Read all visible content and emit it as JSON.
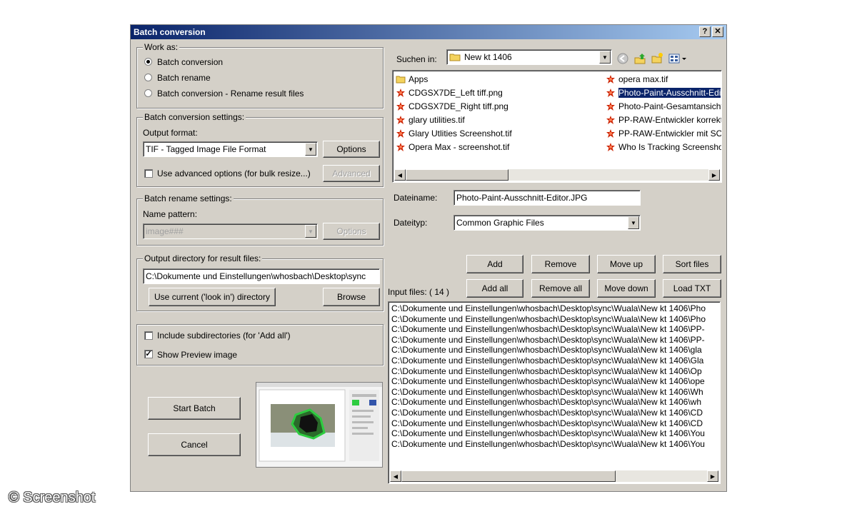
{
  "window": {
    "title": "Batch conversion",
    "help_label": "?",
    "close_label": "✕"
  },
  "work_as": {
    "legend": "Work as:",
    "options": [
      {
        "label": "Batch conversion",
        "selected": true
      },
      {
        "label": "Batch rename",
        "selected": false
      },
      {
        "label": "Batch conversion - Rename result files",
        "selected": false
      }
    ]
  },
  "conversion_settings": {
    "legend": "Batch conversion settings:",
    "output_format_label": "Output format:",
    "output_format_value": "TIF - Tagged Image File Format",
    "options_button": "Options",
    "advanced_checkbox_label": "Use advanced options (for bulk resize...)",
    "advanced_checked": false,
    "advanced_button": "Advanced"
  },
  "rename_settings": {
    "legend": "Batch rename settings:",
    "name_pattern_label": "Name pattern:",
    "name_pattern_value": "image###",
    "options_button": "Options"
  },
  "output_dir": {
    "legend": "Output directory for result files:",
    "path": "C:\\Dokumente und Einstellungen\\whosbach\\Desktop\\sync",
    "use_current_button": "Use current ('look in') directory",
    "browse_button": "Browse"
  },
  "flags": {
    "include_subdirs_label": "Include subdirectories (for 'Add all')",
    "include_subdirs_checked": false,
    "show_preview_label": "Show Preview image",
    "show_preview_checked": true
  },
  "actions": {
    "start_label": "Start Batch",
    "cancel_label": "Cancel"
  },
  "browser": {
    "look_in_label": "Suchen in:",
    "look_in_value": "New kt 1406",
    "files_col1": [
      {
        "name": "Apps",
        "type": "folder"
      },
      {
        "name": "CDGSX7DE_Left tiff.png",
        "type": "image"
      },
      {
        "name": "CDGSX7DE_Right tiff.png",
        "type": "image"
      },
      {
        "name": "glary utilities.tif",
        "type": "image"
      },
      {
        "name": "Glary Utlities Screenshot.tif",
        "type": "image"
      },
      {
        "name": "Opera Max - screenshot.tif",
        "type": "image"
      }
    ],
    "files_col2": [
      {
        "name": "opera max.tif",
        "type": "image",
        "selected": false
      },
      {
        "name": "Photo-Paint-Ausschnitt-Edi",
        "type": "image",
        "selected": true
      },
      {
        "name": "Photo-Paint-Gesamtansicht",
        "type": "image",
        "selected": false
      },
      {
        "name": "PP-RAW-Entwickler korrekt",
        "type": "image",
        "selected": false
      },
      {
        "name": "PP-RAW-Entwickler mit SOI",
        "type": "image",
        "selected": false
      },
      {
        "name": "Who Is Tracking Screensho",
        "type": "image",
        "selected": false
      }
    ],
    "filename_label": "Dateiname:",
    "filename_value": "Photo-Paint-Ausschnitt-Editor.JPG",
    "filetype_label": "Dateityp:",
    "filetype_value": "Common Graphic Files"
  },
  "input": {
    "buttons_row1": [
      "Add",
      "Remove",
      "Move up",
      "Sort files"
    ],
    "buttons_row2": [
      "Add all",
      "Remove all",
      "Move down",
      "Load TXT"
    ],
    "label": "Input files: ( 14 )",
    "files": [
      "C:\\Dokumente und Einstellungen\\whosbach\\Desktop\\sync\\Wuala\\New kt 1406\\Pho",
      "C:\\Dokumente und Einstellungen\\whosbach\\Desktop\\sync\\Wuala\\New kt 1406\\Pho",
      "C:\\Dokumente und Einstellungen\\whosbach\\Desktop\\sync\\Wuala\\New kt 1406\\PP-",
      "C:\\Dokumente und Einstellungen\\whosbach\\Desktop\\sync\\Wuala\\New kt 1406\\PP-",
      "C:\\Dokumente und Einstellungen\\whosbach\\Desktop\\sync\\Wuala\\New kt 1406\\gla",
      "C:\\Dokumente und Einstellungen\\whosbach\\Desktop\\sync\\Wuala\\New kt 1406\\Gla",
      "C:\\Dokumente und Einstellungen\\whosbach\\Desktop\\sync\\Wuala\\New kt 1406\\Op",
      "C:\\Dokumente und Einstellungen\\whosbach\\Desktop\\sync\\Wuala\\New kt 1406\\ope",
      "C:\\Dokumente und Einstellungen\\whosbach\\Desktop\\sync\\Wuala\\New kt 1406\\Wh",
      "C:\\Dokumente und Einstellungen\\whosbach\\Desktop\\sync\\Wuala\\New kt 1406\\wh",
      "C:\\Dokumente und Einstellungen\\whosbach\\Desktop\\sync\\Wuala\\New kt 1406\\CD",
      "C:\\Dokumente und Einstellungen\\whosbach\\Desktop\\sync\\Wuala\\New kt 1406\\CD",
      "C:\\Dokumente und Einstellungen\\whosbach\\Desktop\\sync\\Wuala\\New kt 1406\\You",
      "C:\\Dokumente und Einstellungen\\whosbach\\Desktop\\sync\\Wuala\\New kt 1406\\You"
    ]
  },
  "credit": "© Screenshot",
  "colors": {
    "title_start": "#0a246a",
    "title_end": "#a6caf0",
    "face": "#d4d0c8",
    "selection": "#0a246a",
    "file_icon": "#cc2200"
  }
}
